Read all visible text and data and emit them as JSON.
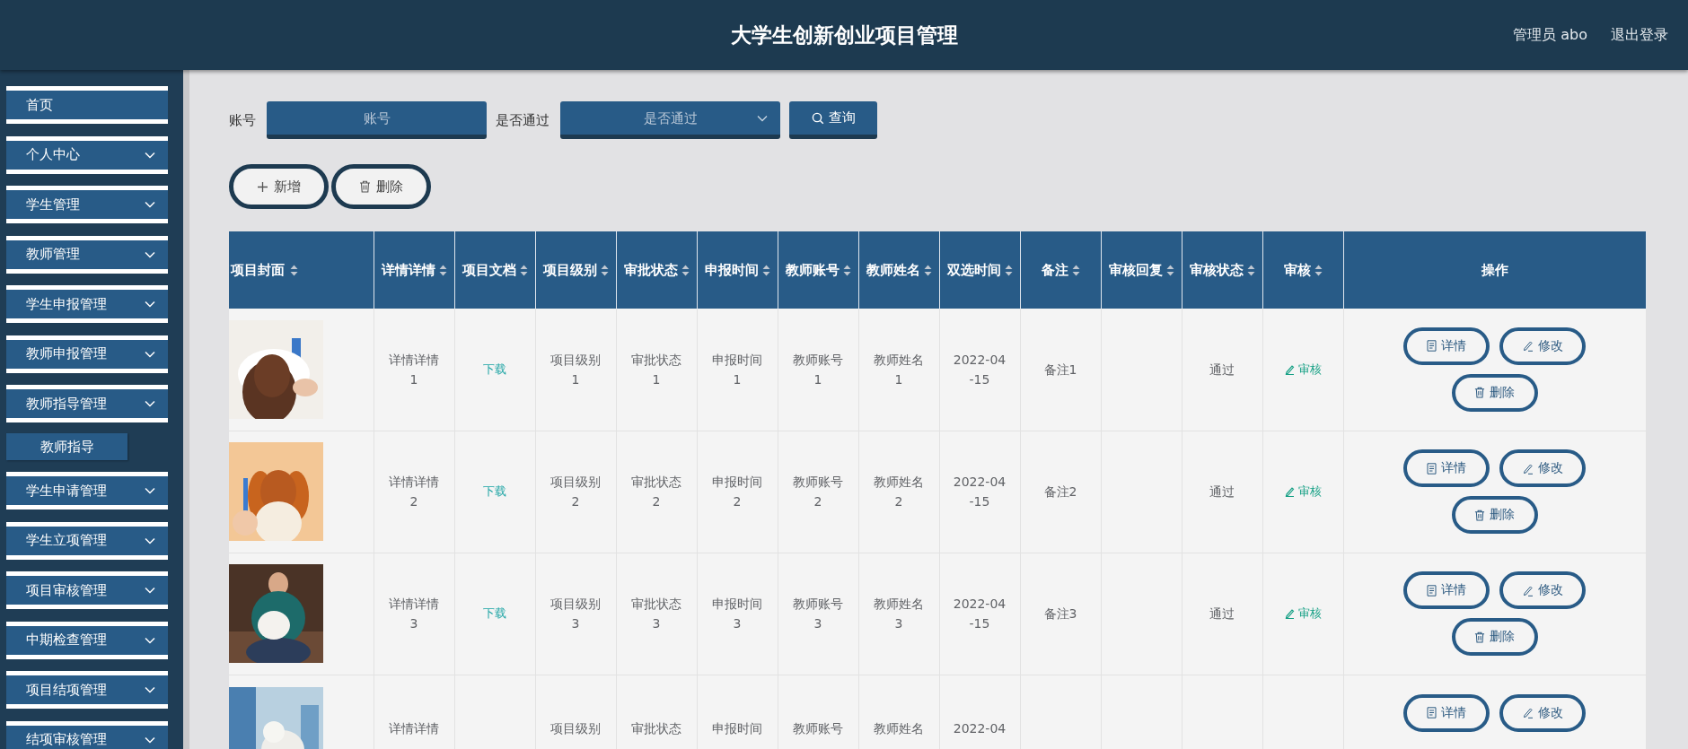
{
  "header": {
    "title": "大学生创新创业项目管理",
    "user": "管理员 abo",
    "logout": "退出登录"
  },
  "sidebar": {
    "items": [
      {
        "label": "首页",
        "kind": "link"
      },
      {
        "label": "个人中心",
        "kind": "menu"
      },
      {
        "label": "学生管理",
        "kind": "menu"
      },
      {
        "label": "教师管理",
        "kind": "menu"
      },
      {
        "label": "学生申报管理",
        "kind": "menu"
      },
      {
        "label": "教师申报管理",
        "kind": "menu"
      },
      {
        "label": "教师指导管理",
        "kind": "menu",
        "children": [
          {
            "label": "教师指导"
          }
        ]
      },
      {
        "label": "学生申请管理",
        "kind": "menu"
      },
      {
        "label": "学生立项管理",
        "kind": "menu"
      },
      {
        "label": "项目审核管理",
        "kind": "menu"
      },
      {
        "label": "中期检查管理",
        "kind": "menu"
      },
      {
        "label": "项目结项管理",
        "kind": "menu"
      },
      {
        "label": "结项审核管理",
        "kind": "menu"
      }
    ]
  },
  "search": {
    "fields": [
      {
        "label": "账号",
        "placeholder": "账号",
        "kind": "input"
      },
      {
        "label": "是否通过",
        "placeholder": "是否通过",
        "kind": "select"
      }
    ],
    "button": "查询"
  },
  "toolbar": [
    {
      "label": "新增",
      "kind": "add"
    },
    {
      "label": "删除",
      "kind": "delete"
    }
  ],
  "table": {
    "columns": [
      {
        "label": "项目封面",
        "sortable": true
      },
      {
        "label": "详情详情",
        "kind": "text",
        "sortable": true
      },
      {
        "label": "项目文档",
        "kind": "file",
        "sortable": true
      },
      {
        "label": "项目级别",
        "kind": "text",
        "sortable": true
      },
      {
        "label": "审批状态",
        "kind": "text",
        "sortable": true
      },
      {
        "label": "申报时间",
        "kind": "text",
        "sortable": true
      },
      {
        "label": "教师账号",
        "kind": "text",
        "sortable": true
      },
      {
        "label": "教师姓名",
        "kind": "text",
        "sortable": true
      },
      {
        "label": "双选时间",
        "kind": "date",
        "sortable": true
      },
      {
        "label": "备注",
        "kind": "text",
        "sortable": true
      },
      {
        "label": "审核回复",
        "kind": "text",
        "sortable": true
      },
      {
        "label": "审核状态",
        "kind": "text",
        "sortable": true
      },
      {
        "label": "审核",
        "kind": "audit",
        "sortable": true
      },
      {
        "label": "操作",
        "kind": "actions",
        "sortable": false
      }
    ],
    "rows": [
      {
        "cells": [
          {
            "kind": "picture"
          },
          "详情详情1",
          "下载",
          "项目级别1",
          "审批状态1",
          "申报时间1",
          "教师账号1",
          "教师姓名1",
          "2022-04-15",
          "备注1",
          null,
          "通过",
          "审核",
          [
            {
              "label": "详情",
              "kind": "detail"
            },
            {
              "label": "修改",
              "kind": "edit"
            },
            {
              "label": "删除",
              "kind": "delete"
            }
          ]
        ]
      },
      {
        "cells": [
          {
            "kind": "picture"
          },
          "详情详情2",
          "下载",
          "项目级别2",
          "审批状态2",
          "申报时间2",
          "教师账号2",
          "教师姓名2",
          "2022-04-15",
          "备注2",
          null,
          "通过",
          "审核",
          [
            {
              "label": "详情",
              "kind": "detail"
            },
            {
              "label": "修改",
              "kind": "edit"
            },
            {
              "label": "删除",
              "kind": "delete"
            }
          ]
        ]
      },
      {
        "cells": [
          {
            "kind": "picture"
          },
          "详情详情3",
          "下载",
          "项目级别3",
          "审批状态3",
          "申报时间3",
          "教师账号3",
          "教师姓名3",
          "2022-04-15",
          "备注3",
          null,
          "通过",
          "审核",
          [
            {
              "label": "详情",
              "kind": "detail"
            },
            {
              "label": "修改",
              "kind": "edit"
            },
            {
              "label": "删除",
              "kind": "delete"
            }
          ]
        ]
      },
      {
        "cells": [
          {
            "kind": "picture"
          },
          "详情详情",
          null,
          "项目级别",
          "审批状态",
          "申报时间",
          "教师账号",
          "教师姓名",
          "2022-04",
          null,
          null,
          null,
          null,
          [
            {
              "label": "详情",
              "kind": "detail"
            },
            {
              "label": "修改",
              "kind": "edit"
            }
          ]
        ]
      }
    ]
  }
}
